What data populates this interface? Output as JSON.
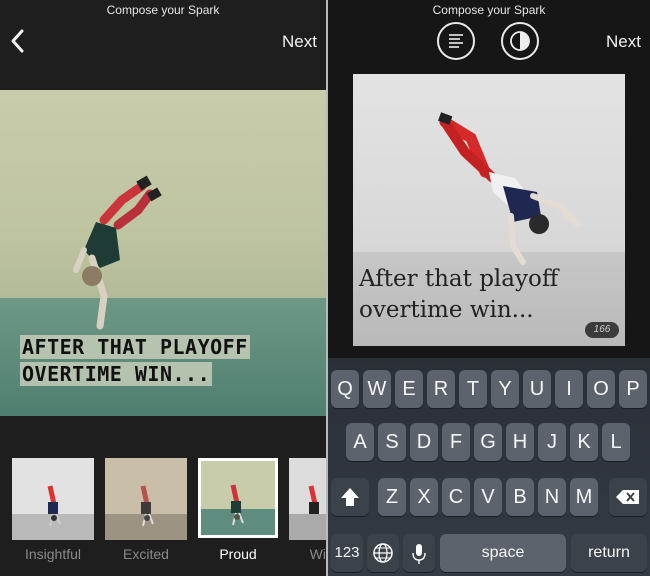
{
  "left": {
    "title": "Compose your Spark",
    "next_label": "Next",
    "caption_line1": "AFTER THAT PLAYOFF",
    "caption_line2": "OVERTIME WIN...",
    "themes": [
      {
        "label": "Insightful",
        "selected": false
      },
      {
        "label": "Excited",
        "selected": false
      },
      {
        "label": "Proud",
        "selected": true
      },
      {
        "label": "Wi",
        "selected": false
      }
    ]
  },
  "right": {
    "title": "Compose your Spark",
    "next_label": "Next",
    "caption_line1": "After that playoff",
    "caption_line2": "overtime win...",
    "char_count": "166",
    "icons": [
      "text-align-icon",
      "contrast-icon"
    ]
  },
  "keyboard": {
    "row1": [
      "Q",
      "W",
      "E",
      "R",
      "T",
      "Y",
      "U",
      "I",
      "O",
      "P"
    ],
    "row2": [
      "A",
      "S",
      "D",
      "F",
      "G",
      "H",
      "J",
      "K",
      "L"
    ],
    "row3": [
      "Z",
      "X",
      "C",
      "V",
      "B",
      "N",
      "M"
    ],
    "numbers_label": "123",
    "space_label": "space",
    "return_label": "return"
  },
  "colors": {
    "selected_border": "#ffffff",
    "shirt_red": "#d62a2a"
  }
}
